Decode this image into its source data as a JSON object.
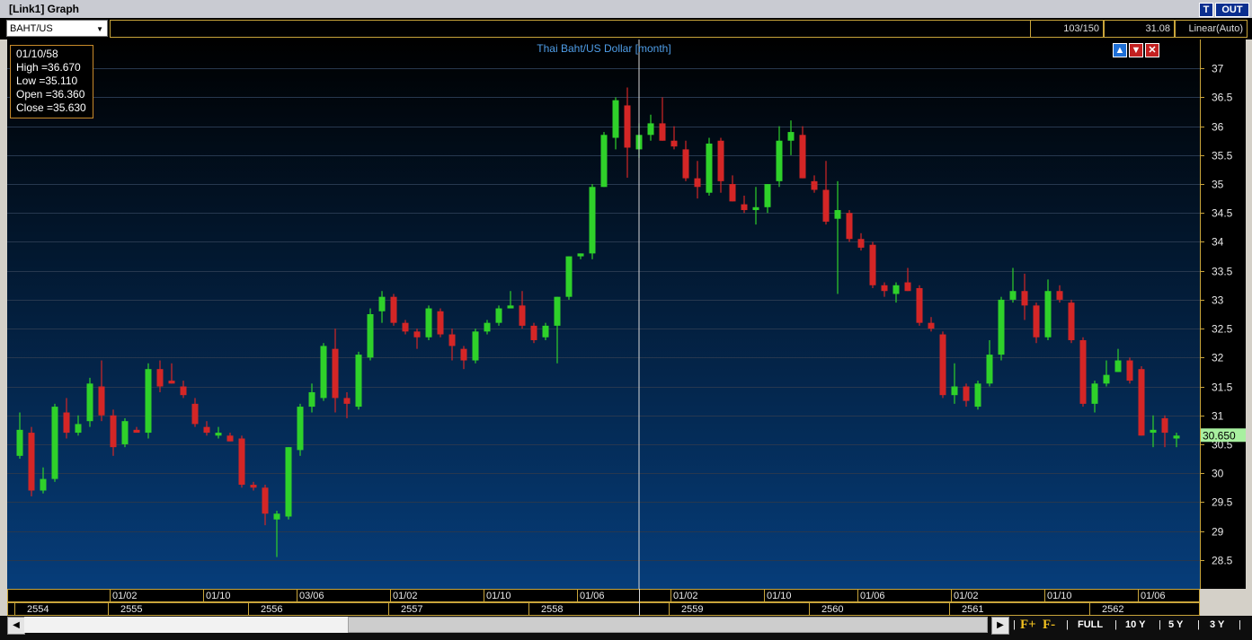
{
  "window": {
    "title": "[Link1] Graph",
    "t_label": "T",
    "out_label": "OUT"
  },
  "toolbar": {
    "symbol": "BAHT/US",
    "counter": "103/150",
    "value": "31.08",
    "scale": "Linear(Auto)"
  },
  "info_box": {
    "date": "01/10/58",
    "high": "High =36.670",
    "low": "Low  =35.110",
    "open": "Open  =36.360",
    "close": "Close  =35.630"
  },
  "chart_controls": {
    "up_icon": "up-arrow-icon",
    "down_icon": "down-arrow-icon",
    "close_icon": "close-icon"
  },
  "colors": {
    "up": "#2fd12a",
    "down": "#d42626",
    "bg_top": "#000000",
    "bg_bottom": "#063d7a",
    "last_price_bg": "#a8f0a0",
    "axis_border": "#c8a43a"
  },
  "bottom": {
    "nav_left": "◀",
    "nav_right": "▶",
    "f_plus": "F+",
    "f_minus": "F-",
    "ranges": [
      "FULL",
      "10 Y",
      "5 Y",
      "3 Y"
    ]
  },
  "chart_data": {
    "type": "candlestick",
    "title": "Thai Baht/US Dollar [month]",
    "ylim": [
      28.0,
      37.5
    ],
    "y_ticks": [
      28.5,
      29,
      29.5,
      30,
      30.5,
      31,
      31.5,
      32,
      32.5,
      33,
      33.5,
      34,
      34.5,
      35,
      35.5,
      36,
      36.5,
      37
    ],
    "last_price": "30.650",
    "crosshair_index": 53,
    "x_ticks_top": [
      {
        "i": 8,
        "label": "01/02"
      },
      {
        "i": 16,
        "label": "01/10"
      },
      {
        "i": 24,
        "label": "03/06"
      },
      {
        "i": 32,
        "label": "01/02"
      },
      {
        "i": 40,
        "label": "01/10"
      },
      {
        "i": 48,
        "label": "01/06"
      },
      {
        "i": 56,
        "label": "01/02"
      },
      {
        "i": 64,
        "label": "01/10"
      },
      {
        "i": 72,
        "label": "01/06"
      },
      {
        "i": 80,
        "label": "01/02"
      },
      {
        "i": 88,
        "label": "01/10"
      },
      {
        "i": 96,
        "label": "01/06"
      }
    ],
    "x_ticks_bottom": [
      {
        "i": 0,
        "label": "2554"
      },
      {
        "i": 8,
        "label": "2555"
      },
      {
        "i": 20,
        "label": "2556"
      },
      {
        "i": 32,
        "label": "2557"
      },
      {
        "i": 44,
        "label": "2558"
      },
      {
        "i": 56,
        "label": "2559"
      },
      {
        "i": 68,
        "label": "2560"
      },
      {
        "i": 80,
        "label": "2561"
      },
      {
        "i": 92,
        "label": "2562"
      }
    ],
    "ohlc": [
      [
        30.3,
        31.05,
        30.25,
        30.75
      ],
      [
        30.7,
        30.8,
        29.6,
        29.7
      ],
      [
        29.7,
        30.1,
        29.65,
        29.9
      ],
      [
        29.9,
        31.2,
        29.85,
        31.15
      ],
      [
        31.05,
        31.3,
        30.6,
        30.7
      ],
      [
        30.7,
        31.0,
        30.65,
        30.85
      ],
      [
        30.9,
        31.65,
        30.8,
        31.55
      ],
      [
        31.5,
        31.95,
        30.9,
        31.0
      ],
      [
        31.0,
        31.1,
        30.3,
        30.45
      ],
      [
        30.5,
        30.95,
        30.45,
        30.9
      ],
      [
        30.75,
        30.8,
        30.7,
        30.7
      ],
      [
        30.7,
        31.9,
        30.6,
        31.8
      ],
      [
        31.8,
        31.95,
        31.4,
        31.5
      ],
      [
        31.6,
        31.9,
        31.55,
        31.55
      ],
      [
        31.5,
        31.6,
        31.3,
        31.35
      ],
      [
        31.2,
        31.3,
        30.8,
        30.85
      ],
      [
        30.8,
        30.9,
        30.65,
        30.7
      ],
      [
        30.65,
        30.8,
        30.6,
        30.7
      ],
      [
        30.65,
        30.7,
        30.55,
        30.55
      ],
      [
        30.6,
        30.65,
        29.75,
        29.8
      ],
      [
        29.8,
        29.85,
        29.7,
        29.75
      ],
      [
        29.75,
        29.8,
        29.1,
        29.3
      ],
      [
        29.2,
        29.35,
        28.55,
        29.3
      ],
      [
        29.25,
        30.45,
        29.2,
        30.45
      ],
      [
        30.4,
        31.2,
        30.3,
        31.15
      ],
      [
        31.15,
        31.55,
        31.05,
        31.4
      ],
      [
        31.3,
        32.25,
        31.25,
        32.2
      ],
      [
        32.15,
        32.5,
        31.05,
        31.3
      ],
      [
        31.3,
        31.4,
        30.95,
        31.2
      ],
      [
        31.15,
        32.1,
        31.1,
        32.05
      ],
      [
        32.0,
        32.85,
        31.95,
        32.75
      ],
      [
        32.8,
        33.15,
        32.6,
        33.05
      ],
      [
        33.05,
        33.1,
        32.55,
        32.6
      ],
      [
        32.6,
        32.65,
        32.4,
        32.45
      ],
      [
        32.45,
        32.5,
        32.15,
        32.35
      ],
      [
        32.35,
        32.9,
        32.3,
        32.85
      ],
      [
        32.8,
        32.85,
        32.35,
        32.4
      ],
      [
        32.4,
        32.5,
        31.95,
        32.2
      ],
      [
        32.15,
        32.2,
        31.8,
        31.95
      ],
      [
        31.95,
        32.5,
        31.9,
        32.45
      ],
      [
        32.45,
        32.65,
        32.4,
        32.6
      ],
      [
        32.6,
        32.9,
        32.55,
        32.85
      ],
      [
        32.85,
        33.15,
        32.85,
        32.9
      ],
      [
        32.9,
        33.15,
        32.5,
        32.55
      ],
      [
        32.55,
        32.6,
        32.25,
        32.3
      ],
      [
        32.35,
        32.6,
        32.3,
        32.55
      ],
      [
        32.55,
        33.05,
        31.9,
        33.05
      ],
      [
        33.05,
        33.75,
        33.0,
        33.75
      ],
      [
        33.75,
        33.8,
        33.7,
        33.8
      ],
      [
        33.8,
        35.0,
        33.7,
        34.95
      ],
      [
        34.95,
        35.9,
        34.95,
        35.85
      ],
      [
        35.8,
        36.5,
        35.6,
        36.45
      ],
      [
        36.36,
        36.67,
        35.11,
        35.63
      ],
      [
        35.6,
        36.05,
        35.45,
        35.85
      ],
      [
        35.85,
        36.2,
        35.75,
        36.05
      ],
      [
        36.05,
        36.5,
        35.75,
        35.75
      ],
      [
        35.75,
        36.0,
        35.6,
        35.65
      ],
      [
        35.6,
        35.75,
        35.05,
        35.1
      ],
      [
        35.1,
        35.4,
        34.75,
        34.95
      ],
      [
        34.85,
        35.8,
        34.8,
        35.7
      ],
      [
        35.75,
        35.8,
        34.85,
        35.05
      ],
      [
        35.0,
        35.15,
        34.7,
        34.7
      ],
      [
        34.65,
        34.8,
        34.5,
        34.55
      ],
      [
        34.55,
        34.95,
        34.3,
        34.6
      ],
      [
        34.6,
        35.0,
        34.5,
        35.0
      ],
      [
        35.05,
        36.0,
        34.95,
        35.75
      ],
      [
        35.75,
        36.1,
        35.5,
        35.9
      ],
      [
        35.85,
        36.0,
        35.1,
        35.1
      ],
      [
        35.05,
        35.15,
        34.85,
        34.9
      ],
      [
        34.9,
        35.4,
        34.3,
        34.35
      ],
      [
        34.4,
        35.05,
        33.1,
        34.55
      ],
      [
        34.5,
        34.55,
        34.0,
        34.05
      ],
      [
        34.05,
        34.15,
        33.85,
        33.9
      ],
      [
        33.95,
        34.0,
        33.2,
        33.25
      ],
      [
        33.25,
        33.3,
        33.05,
        33.15
      ],
      [
        33.1,
        33.3,
        32.95,
        33.25
      ],
      [
        33.3,
        33.55,
        33.15,
        33.15
      ],
      [
        33.2,
        33.25,
        32.55,
        32.6
      ],
      [
        32.6,
        32.7,
        32.45,
        32.5
      ],
      [
        32.4,
        32.45,
        31.3,
        31.35
      ],
      [
        31.35,
        31.9,
        31.2,
        31.5
      ],
      [
        31.5,
        31.55,
        31.15,
        31.25
      ],
      [
        31.15,
        31.6,
        31.1,
        31.55
      ],
      [
        31.55,
        32.3,
        31.5,
        32.05
      ],
      [
        32.05,
        33.05,
        31.95,
        33.0
      ],
      [
        33.0,
        33.55,
        32.95,
        33.15
      ],
      [
        33.15,
        33.45,
        32.65,
        32.9
      ],
      [
        32.9,
        32.95,
        32.25,
        32.35
      ],
      [
        32.35,
        33.35,
        32.3,
        33.15
      ],
      [
        33.15,
        33.25,
        32.95,
        33.0
      ],
      [
        32.95,
        33.0,
        32.25,
        32.3
      ],
      [
        32.3,
        32.35,
        31.15,
        31.2
      ],
      [
        31.2,
        31.6,
        31.05,
        31.55
      ],
      [
        31.55,
        31.95,
        31.5,
        31.7
      ],
      [
        31.75,
        32.15,
        31.75,
        31.95
      ],
      [
        31.95,
        32.0,
        31.55,
        31.6
      ],
      [
        31.8,
        31.85,
        30.65,
        30.65
      ],
      [
        30.7,
        31.0,
        30.45,
        30.75
      ],
      [
        30.95,
        31.0,
        30.45,
        30.7
      ],
      [
        30.6,
        30.7,
        30.45,
        30.65
      ]
    ]
  }
}
